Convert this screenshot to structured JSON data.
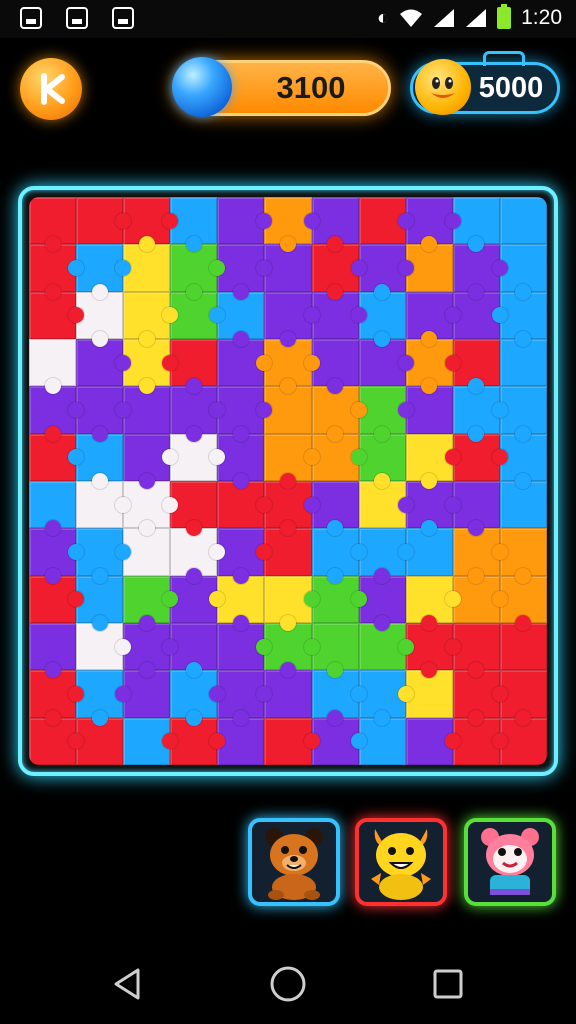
{
  "status_bar": {
    "time": "1:20",
    "notification_icons": [
      "calendar-notification-icon",
      "image-notification-icon",
      "gallery-notification-icon"
    ],
    "system_icons": [
      "data-saver-icon",
      "wifi-icon",
      "signal-icon",
      "signal-icon-2",
      "battery-icon"
    ],
    "battery_color": "#8be82a"
  },
  "hud": {
    "back_icon": "back-arrow-icon",
    "score": "3100",
    "score_icon": "blue-orb-icon",
    "coins": "5000",
    "coin_icon": "duck-coin-icon"
  },
  "board": {
    "columns": 11,
    "rows": 12,
    "frame_color": "#6ff0ff",
    "palette": {
      "R": "#ef1d2e",
      "B": "#1ea7ff",
      "P": "#7b2fe0",
      "O": "#ff9a0f",
      "G": "#4fd42f",
      "Y": "#ffe02a",
      "W": "#f6f1f4"
    },
    "cells": [
      "RRRBPOPRPBB",
      "RBYGPPRPOPB",
      "RWYGBPPBPPB",
      "WPYRPOPPORB",
      "PPPPPOOGPBB",
      "RBPWPOOGYRB",
      "BWWRRRPYPPB",
      "PBWWPRBBBOO",
      "RBGPYYGPYOO",
      "PWPPPGGGRRR",
      "RBPBPPBBYRR",
      "RRBRPRPBPRR"
    ]
  },
  "characters": [
    {
      "name": "bear",
      "icon": "bear-character-icon",
      "border": "#35c2ff"
    },
    {
      "name": "yellow-creature",
      "icon": "yellow-creature-icon",
      "border": "#ff3030"
    },
    {
      "name": "pink-creature",
      "icon": "pink-creature-icon",
      "border": "#58e03a"
    }
  ],
  "nav": {
    "back_icon": "triangle-back-icon",
    "home_icon": "circle-home-icon",
    "recents_icon": "square-recents-icon"
  }
}
